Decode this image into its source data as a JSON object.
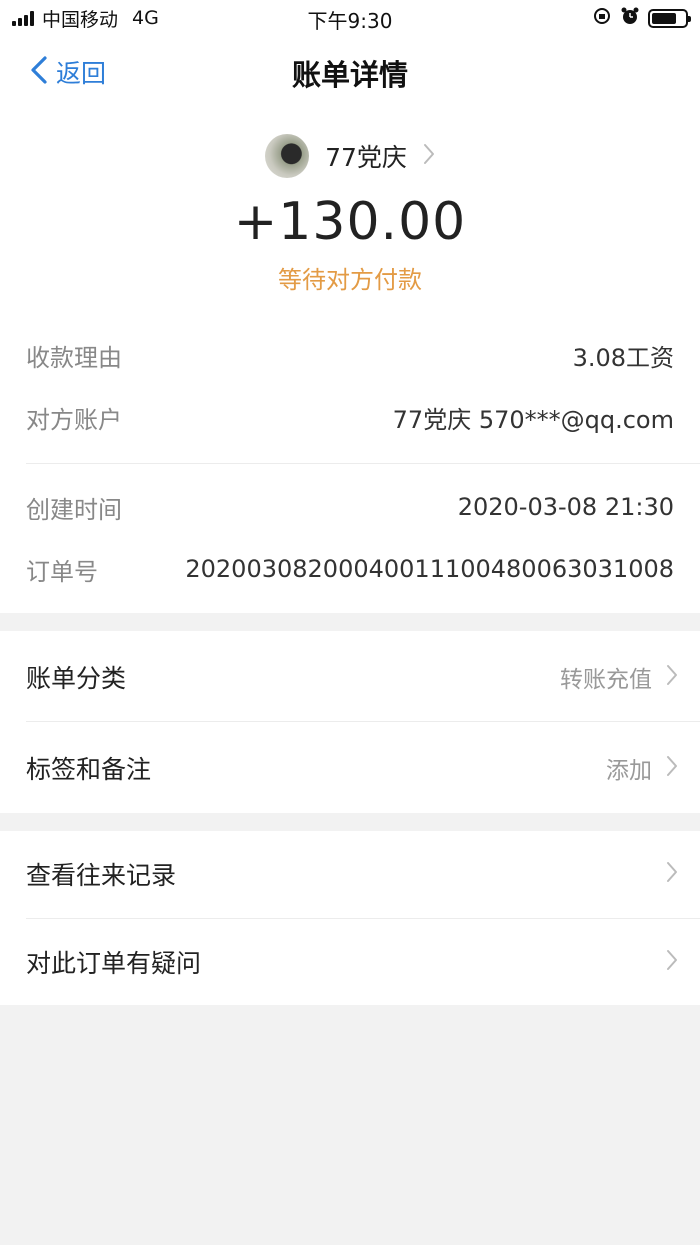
{
  "status_bar": {
    "carrier": "中国移动",
    "network": "4G",
    "time": "下午9:30",
    "battery_level": 0.75
  },
  "nav": {
    "back_label": "返回",
    "title": "账单详情"
  },
  "payee": {
    "name": "77党庆"
  },
  "amount": "+130.00",
  "status_text": "等待对方付款",
  "details": [
    {
      "label": "收款理由",
      "value": "3.08工资"
    },
    {
      "label": "对方账户",
      "value": "77党庆 570***@qq.com"
    },
    {
      "label": "创建时间",
      "value": "2020-03-08 21:30"
    },
    {
      "label": "订单号",
      "value": "20200308200040011100480063031008"
    }
  ],
  "menu_group1": [
    {
      "label": "账单分类",
      "value": "转账充值"
    },
    {
      "label": "标签和备注",
      "value": "添加"
    }
  ],
  "menu_group2": [
    {
      "label": "查看往来记录"
    },
    {
      "label": "对此订单有疑问"
    }
  ],
  "colors": {
    "accent_blue": "#2e7ed8",
    "status_orange": "#e39b45",
    "background": "#f2f2f2"
  }
}
